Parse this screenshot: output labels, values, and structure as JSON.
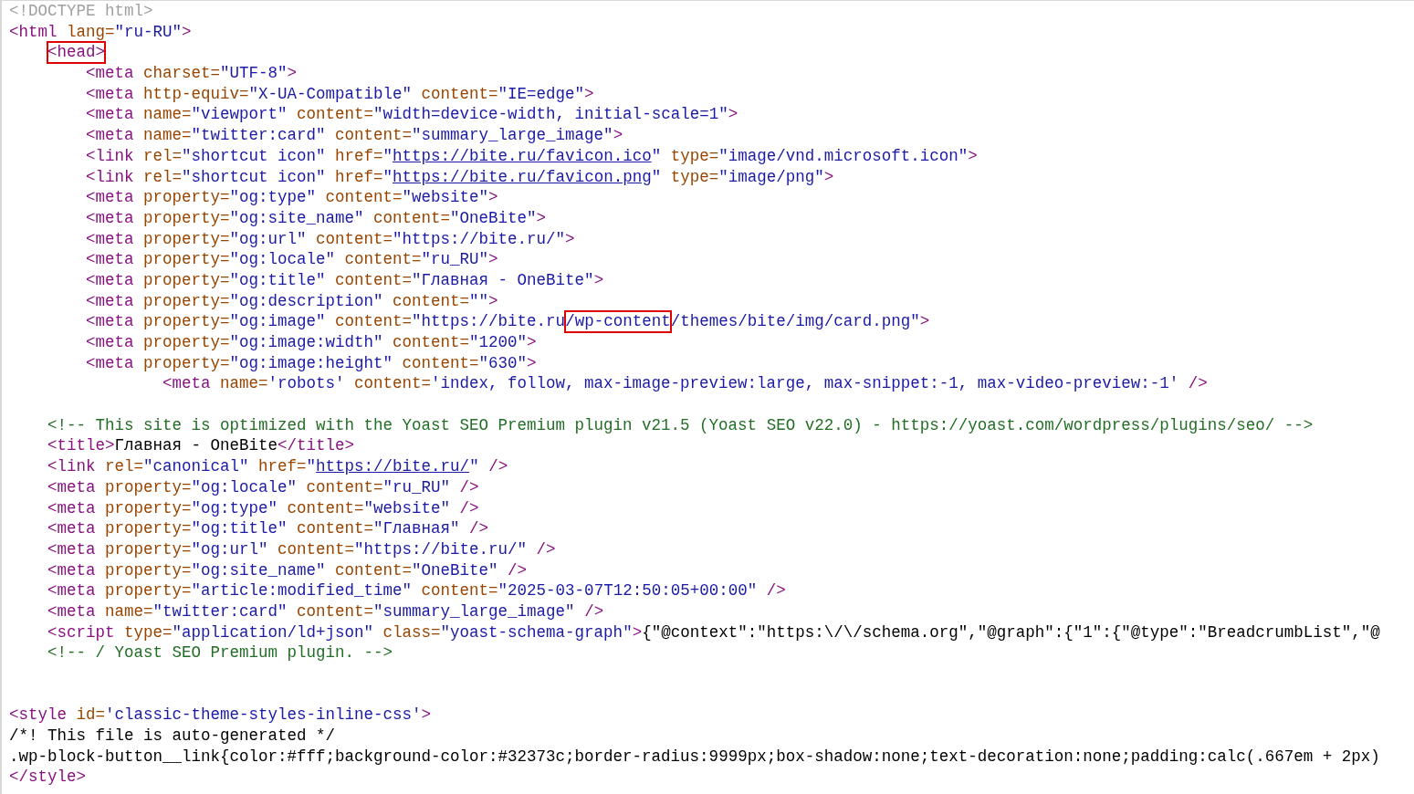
{
  "source_lines": [
    {
      "kind": "top",
      "tokens": [
        {
          "kind": "doctype",
          "text": "<!DOCTYPE html>"
        }
      ]
    },
    {
      "kind": "top",
      "tokens": [
        {
          "kind": "tag",
          "text": "<html"
        },
        {
          "kind": "attr",
          "text": " lang="
        },
        {
          "kind": "value",
          "text": "\"ru-RU\""
        },
        {
          "kind": "tag",
          "text": ">"
        }
      ]
    },
    {
      "kind": "child",
      "tokens": [
        {
          "kind": "tag",
          "text": "<head>",
          "highlighted": true
        }
      ]
    },
    {
      "kind": "grandchild",
      "tokens": [
        {
          "kind": "tag",
          "text": "<meta"
        },
        {
          "kind": "attr",
          "text": " charset="
        },
        {
          "kind": "value",
          "text": "\"UTF-8\""
        },
        {
          "kind": "tag",
          "text": ">"
        }
      ]
    },
    {
      "kind": "grandchild",
      "tokens": [
        {
          "kind": "tag",
          "text": "<meta"
        },
        {
          "kind": "attr",
          "text": " http-equiv="
        },
        {
          "kind": "value",
          "text": "\"X-UA-Compatible\""
        },
        {
          "kind": "attr",
          "text": " content="
        },
        {
          "kind": "value",
          "text": "\"IE=edge\""
        },
        {
          "kind": "tag",
          "text": ">"
        }
      ]
    },
    {
      "kind": "grandchild",
      "tokens": [
        {
          "kind": "tag",
          "text": "<meta"
        },
        {
          "kind": "attr",
          "text": " name="
        },
        {
          "kind": "value",
          "text": "\"viewport\""
        },
        {
          "kind": "attr",
          "text": " content="
        },
        {
          "kind": "value",
          "text": "\"width=device-width, initial-scale=1\""
        },
        {
          "kind": "tag",
          "text": ">"
        }
      ]
    },
    {
      "kind": "grandchild",
      "tokens": [
        {
          "kind": "tag",
          "text": "<meta"
        },
        {
          "kind": "attr",
          "text": " name="
        },
        {
          "kind": "value",
          "text": "\"twitter:card\""
        },
        {
          "kind": "attr",
          "text": " content="
        },
        {
          "kind": "value",
          "text": "\"summary_large_image\""
        },
        {
          "kind": "tag",
          "text": ">"
        }
      ]
    },
    {
      "kind": "grandchild",
      "tokens": [
        {
          "kind": "tag",
          "text": "<link"
        },
        {
          "kind": "attr",
          "text": " rel="
        },
        {
          "kind": "value",
          "text": "\"shortcut icon\""
        },
        {
          "kind": "attr",
          "text": " href="
        },
        {
          "kind": "value",
          "text": "\""
        },
        {
          "kind": "link",
          "text": "https://bite.ru/favicon.ico"
        },
        {
          "kind": "value",
          "text": "\""
        },
        {
          "kind": "attr",
          "text": " type="
        },
        {
          "kind": "value",
          "text": "\"image/vnd.microsoft.icon\""
        },
        {
          "kind": "tag",
          "text": ">"
        }
      ]
    },
    {
      "kind": "grandchild",
      "tokens": [
        {
          "kind": "tag",
          "text": "<link"
        },
        {
          "kind": "attr",
          "text": " rel="
        },
        {
          "kind": "value",
          "text": "\"shortcut icon\""
        },
        {
          "kind": "attr",
          "text": " href="
        },
        {
          "kind": "value",
          "text": "\""
        },
        {
          "kind": "link",
          "text": "https://bite.ru/favicon.png"
        },
        {
          "kind": "value",
          "text": "\""
        },
        {
          "kind": "attr",
          "text": " type="
        },
        {
          "kind": "value",
          "text": "\"image/png\""
        },
        {
          "kind": "tag",
          "text": ">"
        }
      ]
    },
    {
      "kind": "grandchild",
      "tokens": [
        {
          "kind": "tag",
          "text": "<meta"
        },
        {
          "kind": "attr",
          "text": " property="
        },
        {
          "kind": "value",
          "text": "\"og:type\""
        },
        {
          "kind": "attr",
          "text": " content="
        },
        {
          "kind": "value",
          "text": "\"website\""
        },
        {
          "kind": "tag",
          "text": ">"
        }
      ]
    },
    {
      "kind": "grandchild",
      "tokens": [
        {
          "kind": "tag",
          "text": "<meta"
        },
        {
          "kind": "attr",
          "text": " property="
        },
        {
          "kind": "value",
          "text": "\"og:site_name\""
        },
        {
          "kind": "attr",
          "text": " content="
        },
        {
          "kind": "value",
          "text": "\"OneBite\""
        },
        {
          "kind": "tag",
          "text": ">"
        }
      ]
    },
    {
      "kind": "grandchild",
      "tokens": [
        {
          "kind": "tag",
          "text": "<meta"
        },
        {
          "kind": "attr",
          "text": " property="
        },
        {
          "kind": "value",
          "text": "\"og:url\""
        },
        {
          "kind": "attr",
          "text": " content="
        },
        {
          "kind": "value",
          "text": "\"https://bite.ru/\""
        },
        {
          "kind": "tag",
          "text": ">"
        }
      ]
    },
    {
      "kind": "grandchild",
      "tokens": [
        {
          "kind": "tag",
          "text": "<meta"
        },
        {
          "kind": "attr",
          "text": " property="
        },
        {
          "kind": "value",
          "text": "\"og:locale\""
        },
        {
          "kind": "attr",
          "text": " content="
        },
        {
          "kind": "value",
          "text": "\"ru_RU\""
        },
        {
          "kind": "tag",
          "text": ">"
        }
      ]
    },
    {
      "kind": "grandchild",
      "tokens": [
        {
          "kind": "tag",
          "text": "<meta"
        },
        {
          "kind": "attr",
          "text": " property="
        },
        {
          "kind": "value",
          "text": "\"og:title\""
        },
        {
          "kind": "attr",
          "text": " content="
        },
        {
          "kind": "value",
          "text": "\"Главная - OneBite\""
        },
        {
          "kind": "tag",
          "text": ">"
        }
      ]
    },
    {
      "kind": "grandchild",
      "tokens": [
        {
          "kind": "tag",
          "text": "<meta"
        },
        {
          "kind": "attr",
          "text": " property="
        },
        {
          "kind": "value",
          "text": "\"og:description\""
        },
        {
          "kind": "attr",
          "text": " content="
        },
        {
          "kind": "value",
          "text": "\"\""
        },
        {
          "kind": "tag",
          "text": ">"
        }
      ]
    },
    {
      "kind": "grandchild",
      "tokens": [
        {
          "kind": "tag",
          "text": "<meta"
        },
        {
          "kind": "attr",
          "text": " property="
        },
        {
          "kind": "value",
          "text": "\"og:image\""
        },
        {
          "kind": "attr",
          "text": " content="
        },
        {
          "kind": "value",
          "text": "\"https://bite.ru"
        },
        {
          "kind": "value",
          "text": "/wp-content",
          "highlighted": true
        },
        {
          "kind": "value",
          "text": "/themes/bite/img/card.png\""
        },
        {
          "kind": "tag",
          "text": ">"
        }
      ]
    },
    {
      "kind": "grandchild",
      "tokens": [
        {
          "kind": "tag",
          "text": "<meta"
        },
        {
          "kind": "attr",
          "text": " property="
        },
        {
          "kind": "value",
          "text": "\"og:image:width\""
        },
        {
          "kind": "attr",
          "text": " content="
        },
        {
          "kind": "value",
          "text": "\"1200\""
        },
        {
          "kind": "tag",
          "text": ">"
        }
      ]
    },
    {
      "kind": "grandchild",
      "tokens": [
        {
          "kind": "tag",
          "text": "<meta"
        },
        {
          "kind": "attr",
          "text": " property="
        },
        {
          "kind": "value",
          "text": "\"og:image:height\""
        },
        {
          "kind": "attr",
          "text": " content="
        },
        {
          "kind": "value",
          "text": "\"630\""
        },
        {
          "kind": "tag",
          "text": ">"
        }
      ]
    },
    {
      "kind": "deep",
      "tokens": [
        {
          "kind": "tag",
          "text": "<meta"
        },
        {
          "kind": "attr",
          "text": " name="
        },
        {
          "kind": "value",
          "text": "'robots'"
        },
        {
          "kind": "attr",
          "text": " content="
        },
        {
          "kind": "value",
          "text": "'index, follow, max-image-preview:large, max-snippet:-1, max-video-preview:-1'"
        },
        {
          "kind": "tag",
          "text": " />"
        }
      ]
    },
    {
      "kind": "blank"
    },
    {
      "kind": "child",
      "tokens": [
        {
          "kind": "comment",
          "text": "<!-- This site is optimized with the Yoast SEO Premium plugin v21.5 (Yoast SEO v22.0) - https://yoast.com/wordpress/plugins/seo/ -->"
        }
      ]
    },
    {
      "kind": "child",
      "tokens": [
        {
          "kind": "tag",
          "text": "<title>"
        },
        {
          "kind": "text",
          "text": "Главная - OneBite"
        },
        {
          "kind": "tag",
          "text": "</title>"
        }
      ]
    },
    {
      "kind": "child",
      "tokens": [
        {
          "kind": "tag",
          "text": "<link"
        },
        {
          "kind": "attr",
          "text": " rel="
        },
        {
          "kind": "value",
          "text": "\"canonical\""
        },
        {
          "kind": "attr",
          "text": " href="
        },
        {
          "kind": "value",
          "text": "\""
        },
        {
          "kind": "link",
          "text": "https://bite.ru/"
        },
        {
          "kind": "value",
          "text": "\""
        },
        {
          "kind": "tag",
          "text": " />"
        }
      ]
    },
    {
      "kind": "child",
      "tokens": [
        {
          "kind": "tag",
          "text": "<meta"
        },
        {
          "kind": "attr",
          "text": " property="
        },
        {
          "kind": "value",
          "text": "\"og:locale\""
        },
        {
          "kind": "attr",
          "text": " content="
        },
        {
          "kind": "value",
          "text": "\"ru_RU\""
        },
        {
          "kind": "tag",
          "text": " />"
        }
      ]
    },
    {
      "kind": "child",
      "tokens": [
        {
          "kind": "tag",
          "text": "<meta"
        },
        {
          "kind": "attr",
          "text": " property="
        },
        {
          "kind": "value",
          "text": "\"og:type\""
        },
        {
          "kind": "attr",
          "text": " content="
        },
        {
          "kind": "value",
          "text": "\"website\""
        },
        {
          "kind": "tag",
          "text": " />"
        }
      ]
    },
    {
      "kind": "child",
      "tokens": [
        {
          "kind": "tag",
          "text": "<meta"
        },
        {
          "kind": "attr",
          "text": " property="
        },
        {
          "kind": "value",
          "text": "\"og:title\""
        },
        {
          "kind": "attr",
          "text": " content="
        },
        {
          "kind": "value",
          "text": "\"Главная\""
        },
        {
          "kind": "tag",
          "text": " />"
        }
      ]
    },
    {
      "kind": "child",
      "tokens": [
        {
          "kind": "tag",
          "text": "<meta"
        },
        {
          "kind": "attr",
          "text": " property="
        },
        {
          "kind": "value",
          "text": "\"og:url\""
        },
        {
          "kind": "attr",
          "text": " content="
        },
        {
          "kind": "value",
          "text": "\"https://bite.ru/\""
        },
        {
          "kind": "tag",
          "text": " />"
        }
      ]
    },
    {
      "kind": "child",
      "tokens": [
        {
          "kind": "tag",
          "text": "<meta"
        },
        {
          "kind": "attr",
          "text": " property="
        },
        {
          "kind": "value",
          "text": "\"og:site_name\""
        },
        {
          "kind": "attr",
          "text": " content="
        },
        {
          "kind": "value",
          "text": "\"OneBite\""
        },
        {
          "kind": "tag",
          "text": " />"
        }
      ]
    },
    {
      "kind": "child",
      "tokens": [
        {
          "kind": "tag",
          "text": "<meta"
        },
        {
          "kind": "attr",
          "text": " property="
        },
        {
          "kind": "value",
          "text": "\"article:modified_time\""
        },
        {
          "kind": "attr",
          "text": " content="
        },
        {
          "kind": "value",
          "text": "\"2025-03-07T12:50:05+00:00\""
        },
        {
          "kind": "tag",
          "text": " />"
        }
      ]
    },
    {
      "kind": "child",
      "tokens": [
        {
          "kind": "tag",
          "text": "<meta"
        },
        {
          "kind": "attr",
          "text": " name="
        },
        {
          "kind": "value",
          "text": "\"twitter:card\""
        },
        {
          "kind": "attr",
          "text": " content="
        },
        {
          "kind": "value",
          "text": "\"summary_large_image\""
        },
        {
          "kind": "tag",
          "text": " />"
        }
      ]
    },
    {
      "kind": "child",
      "tokens": [
        {
          "kind": "tag",
          "text": "<script"
        },
        {
          "kind": "attr",
          "text": " type="
        },
        {
          "kind": "value",
          "text": "\"application/ld+json\""
        },
        {
          "kind": "attr",
          "text": " class="
        },
        {
          "kind": "value",
          "text": "\"yoast-schema-graph\""
        },
        {
          "kind": "tag",
          "text": ">"
        },
        {
          "kind": "text",
          "text": "{\"@context\":\"https:\\/\\/schema.org\",\"@graph\":{\"1\":{\"@type\":\"BreadcrumbList\",\"@"
        }
      ]
    },
    {
      "kind": "child",
      "tokens": [
        {
          "kind": "comment",
          "text": "<!-- / Yoast SEO Premium plugin. -->"
        }
      ]
    },
    {
      "kind": "blank"
    },
    {
      "kind": "blank"
    },
    {
      "kind": "top",
      "tokens": [
        {
          "kind": "tag",
          "text": "<style"
        },
        {
          "kind": "attr",
          "text": " id="
        },
        {
          "kind": "value",
          "text": "'classic-theme-styles-inline-css'"
        },
        {
          "kind": "tag",
          "text": ">"
        }
      ]
    },
    {
      "kind": "top",
      "tokens": [
        {
          "kind": "text",
          "text": "/*! This file is auto-generated */"
        }
      ]
    },
    {
      "kind": "top",
      "tokens": [
        {
          "kind": "text",
          "text": ".wp-block-button__link{color:#fff;background-color:#32373c;border-radius:9999px;box-shadow:none;text-decoration:none;padding:calc(.667em + 2px)"
        }
      ]
    },
    {
      "kind": "top",
      "tokens": [
        {
          "kind": "tag",
          "text": "</style>"
        }
      ]
    }
  ]
}
